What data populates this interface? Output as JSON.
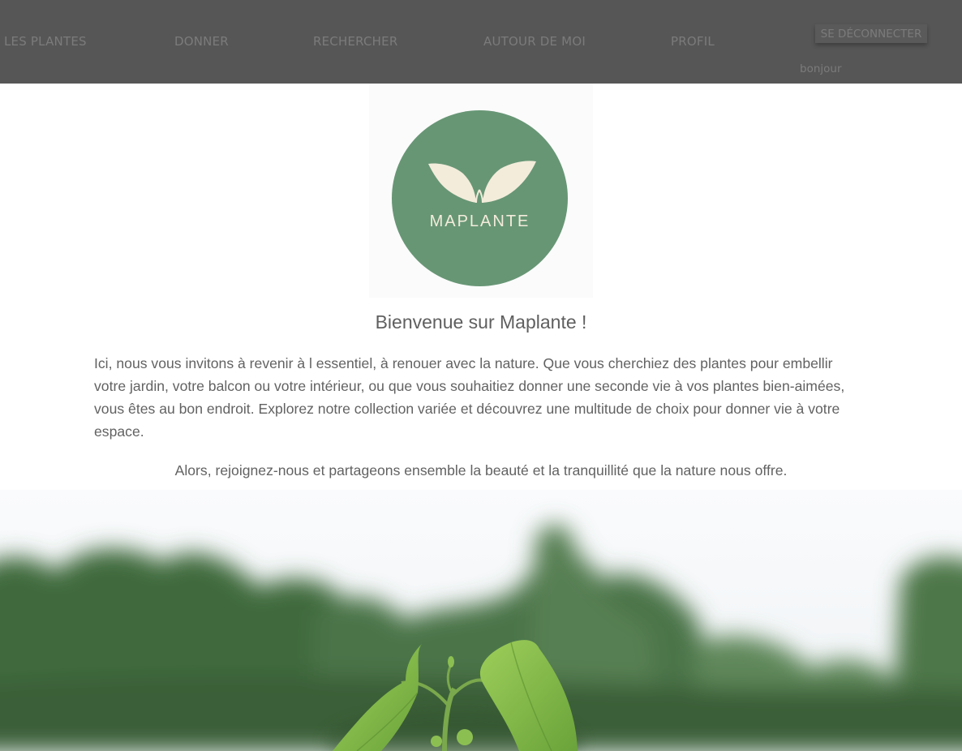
{
  "nav": {
    "items": [
      {
        "label": "LES PLANTES"
      },
      {
        "label": "DONNER"
      },
      {
        "label": "RECHERCHER"
      },
      {
        "label": "AUTOUR DE MOI"
      },
      {
        "label": "PROFIL"
      }
    ],
    "logout_label": "SE DÉCONNECTER",
    "greeting": "bonjour"
  },
  "logo": {
    "text": "MAPLANTE",
    "icon": "leaf-sprout-icon"
  },
  "main": {
    "title": "Bienvenue sur Maplante !",
    "intro": "Ici, nous vous invitons à revenir à l essentiel, à renouer avec la nature. Que vous cherchiez des plantes pour embellir votre jardin, votre balcon ou votre intérieur, ou que vous souhaitiez donner une seconde vie à vos plantes bien-aimées, vous êtes au bon endroit. Explorez notre collection variée et découvrez une multitude de choix pour donner vie à votre espace.",
    "closing": "Alors, rejoignez-nous et partageons ensemble la beauté et la tranquillité que la nature nous offre."
  },
  "colors": {
    "navbar": "#565656",
    "nav_text": "#7b7b7b",
    "logo_green": "#679675",
    "logo_cream": "#f3ecdb",
    "body_text": "#626262"
  }
}
